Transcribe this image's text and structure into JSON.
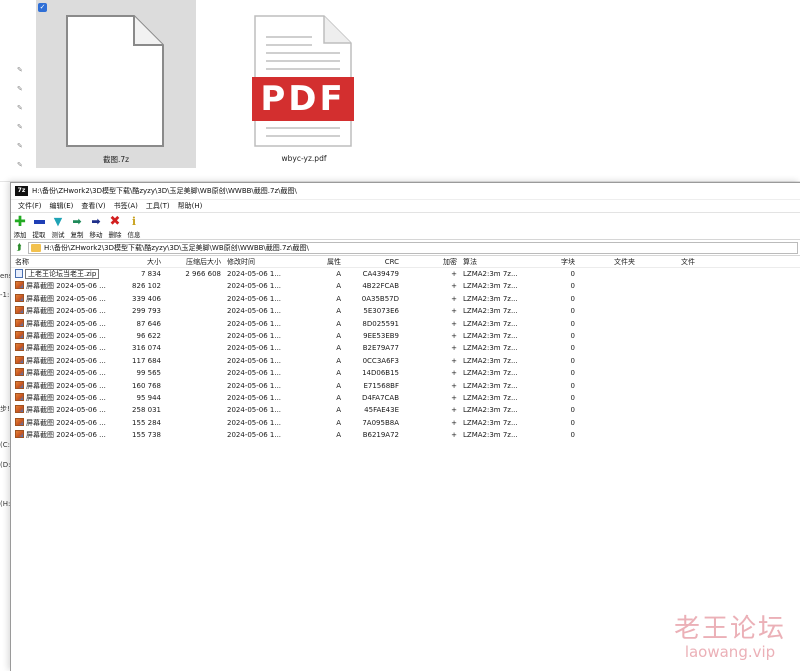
{
  "explorer": {
    "left_edge_texts": [
      "ens",
      "-1:",
      "步!",
      "(C:)",
      "(D:",
      "(H:"
    ],
    "files": [
      {
        "name": "截图.7z",
        "type": "blank-document",
        "selected": true
      },
      {
        "name": "wbyc-yz.pdf",
        "type": "pdf-document",
        "selected": false
      }
    ],
    "pdf_badge": "PDF",
    "accent_color": "#d32f2f",
    "checkbox_color": "#2f6fd6"
  },
  "window": {
    "app_icon": "7z",
    "title": "H:\\备份\\ZHwork2\\3D模型下载\\酷zyzy\\3D\\玉足美脚\\WB原创\\WWBB\\截图.7z\\截图\\",
    "menu": [
      "文件(F)",
      "编辑(E)",
      "查看(V)",
      "书签(A)",
      "工具(T)",
      "帮助(H)"
    ],
    "toolbar": [
      {
        "label": "添加",
        "icon": "add-icon",
        "color": "#22aa22"
      },
      {
        "label": "提取",
        "icon": "extract-icon",
        "color": "#1f3fb5"
      },
      {
        "label": "测试",
        "icon": "test-icon",
        "color": "#1fa3b5"
      },
      {
        "label": "复制",
        "icon": "copy-icon",
        "color": "#1f8a5a"
      },
      {
        "label": "移动",
        "icon": "move-icon",
        "color": "#1f2f8a"
      },
      {
        "label": "删除",
        "icon": "delete-icon",
        "color": "#d21f1f"
      },
      {
        "label": "信息",
        "icon": "info-icon",
        "color": "#c9a21f"
      }
    ],
    "address": "H:\\备份\\ZHwork2\\3D模型下载\\酷zyzy\\3D\\玉足美脚\\WB原创\\WWBB\\截图.7z\\截图\\",
    "columns": [
      "名称",
      "大小",
      "压缩后大小",
      "修改时间",
      "属性",
      "CRC",
      "加密",
      "算法",
      "字块",
      "文件夹",
      "文件"
    ],
    "rows": [
      {
        "name": "上老王论坛当老王.zip",
        "size": "7 834",
        "packed": "2 966 608",
        "modified": "2024-05-06 1...",
        "attr": "A",
        "crc": "CA439479",
        "enc": "+",
        "method": "LZMA2:3m 7z...",
        "block": "0",
        "kind": "zip"
      },
      {
        "name": "屏幕截图 2024-05-06 ...",
        "size": "826 102",
        "packed": "",
        "modified": "2024-05-06 1...",
        "attr": "A",
        "crc": "4B22FCAB",
        "enc": "+",
        "method": "LZMA2:3m 7z...",
        "block": "0",
        "kind": "img"
      },
      {
        "name": "屏幕截图 2024-05-06 ...",
        "size": "339 406",
        "packed": "",
        "modified": "2024-05-06 1...",
        "attr": "A",
        "crc": "0A35B57D",
        "enc": "+",
        "method": "LZMA2:3m 7z...",
        "block": "0",
        "kind": "img"
      },
      {
        "name": "屏幕截图 2024-05-06 ...",
        "size": "299 793",
        "packed": "",
        "modified": "2024-05-06 1...",
        "attr": "A",
        "crc": "5E3073E6",
        "enc": "+",
        "method": "LZMA2:3m 7z...",
        "block": "0",
        "kind": "img"
      },
      {
        "name": "屏幕截图 2024-05-06 ...",
        "size": "87 646",
        "packed": "",
        "modified": "2024-05-06 1...",
        "attr": "A",
        "crc": "8D025591",
        "enc": "+",
        "method": "LZMA2:3m 7z...",
        "block": "0",
        "kind": "img"
      },
      {
        "name": "屏幕截图 2024-05-06 ...",
        "size": "96 622",
        "packed": "",
        "modified": "2024-05-06 1...",
        "attr": "A",
        "crc": "9EE53EB9",
        "enc": "+",
        "method": "LZMA2:3m 7z...",
        "block": "0",
        "kind": "img"
      },
      {
        "name": "屏幕截图 2024-05-06 ...",
        "size": "316 074",
        "packed": "",
        "modified": "2024-05-06 1...",
        "attr": "A",
        "crc": "B2E79A77",
        "enc": "+",
        "method": "LZMA2:3m 7z...",
        "block": "0",
        "kind": "img"
      },
      {
        "name": "屏幕截图 2024-05-06 ...",
        "size": "117 684",
        "packed": "",
        "modified": "2024-05-06 1...",
        "attr": "A",
        "crc": "0CC3A6F3",
        "enc": "+",
        "method": "LZMA2:3m 7z...",
        "block": "0",
        "kind": "img"
      },
      {
        "name": "屏幕截图 2024-05-06 ...",
        "size": "99 565",
        "packed": "",
        "modified": "2024-05-06 1...",
        "attr": "A",
        "crc": "14D06B15",
        "enc": "+",
        "method": "LZMA2:3m 7z...",
        "block": "0",
        "kind": "img"
      },
      {
        "name": "屏幕截图 2024-05-06 ...",
        "size": "160 768",
        "packed": "",
        "modified": "2024-05-06 1...",
        "attr": "A",
        "crc": "E71568BF",
        "enc": "+",
        "method": "LZMA2:3m 7z...",
        "block": "0",
        "kind": "img"
      },
      {
        "name": "屏幕截图 2024-05-06 ...",
        "size": "95 944",
        "packed": "",
        "modified": "2024-05-06 1...",
        "attr": "A",
        "crc": "D4FA7CAB",
        "enc": "+",
        "method": "LZMA2:3m 7z...",
        "block": "0",
        "kind": "img"
      },
      {
        "name": "屏幕截图 2024-05-06 ...",
        "size": "258 031",
        "packed": "",
        "modified": "2024-05-06 1...",
        "attr": "A",
        "crc": "45FAE43E",
        "enc": "+",
        "method": "LZMA2:3m 7z...",
        "block": "0",
        "kind": "img"
      },
      {
        "name": "屏幕截图 2024-05-06 ...",
        "size": "155 284",
        "packed": "",
        "modified": "2024-05-06 1...",
        "attr": "A",
        "crc": "7A095B8A",
        "enc": "+",
        "method": "LZMA2:3m 7z...",
        "block": "0",
        "kind": "img"
      },
      {
        "name": "屏幕截图 2024-05-06 ...",
        "size": "155 738",
        "packed": "",
        "modified": "2024-05-06 1...",
        "attr": "A",
        "crc": "B6219A72",
        "enc": "+",
        "method": "LZMA2:3m 7z...",
        "block": "0",
        "kind": "img"
      }
    ]
  },
  "watermark": {
    "text_cn": "老王论坛",
    "text_en": "laowang.vip",
    "color": "#e8a3ab"
  }
}
